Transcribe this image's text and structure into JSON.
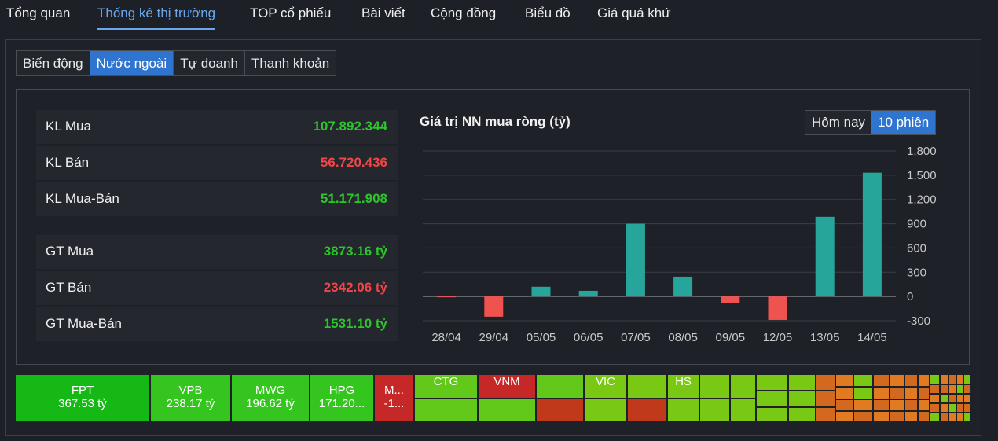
{
  "nav": {
    "items": [
      "Tổng quan",
      "Thống kê thị trường",
      "TOP cổ phiếu",
      "Bài viết",
      "Cộng đồng",
      "Biểu đồ",
      "Giá quá khứ"
    ],
    "active": "Thống kê thị trường"
  },
  "sub_tabs": {
    "items": [
      "Biến động",
      "Nước ngoài",
      "Tự doanh",
      "Thanh khoản"
    ],
    "active": "Nước ngoài"
  },
  "stats": [
    {
      "label": "KL Mua",
      "value": "107.892.344",
      "tone": "green"
    },
    {
      "label": "KL Bán",
      "value": "56.720.436",
      "tone": "red"
    },
    {
      "label": "KL Mua-Bán",
      "value": "51.171.908",
      "tone": "green"
    },
    {
      "label": "GT Mua",
      "value": "3873.16 tỷ",
      "tone": "green"
    },
    {
      "label": "GT Bán",
      "value": "2342.06 tỷ",
      "tone": "red"
    },
    {
      "label": "GT Mua-Bán",
      "value": "1531.10 tỷ",
      "tone": "green"
    }
  ],
  "chart": {
    "title": "Giá trị NN mua ròng (tỷ)",
    "range_options": [
      "Hôm nay",
      "10 phiên"
    ],
    "range_active": "10 phiên"
  },
  "chart_data": {
    "type": "bar",
    "title": "Giá trị NN mua ròng (tỷ)",
    "categories": [
      "28/04",
      "29/04",
      "05/05",
      "06/05",
      "07/05",
      "08/05",
      "09/05",
      "12/05",
      "13/05",
      "14/05"
    ],
    "values": [
      -5,
      -250,
      120,
      70,
      900,
      245,
      -80,
      -290,
      985,
      1531
    ],
    "ylim": [
      -300,
      1800
    ],
    "yticks": [
      "1,800",
      "1,500",
      "1,200",
      "900",
      "600",
      "300",
      "0",
      "-300"
    ],
    "ytick_values": [
      1800,
      1500,
      1200,
      900,
      600,
      300,
      0,
      -300
    ],
    "positive_color": "#26a69a",
    "negative_color": "#ef5350",
    "grid": true
  },
  "treemap": {
    "items": [
      {
        "code": "FPT",
        "value": "367.53 tỷ"
      },
      {
        "code": "VPB",
        "value": "238.17 tỷ"
      },
      {
        "code": "MWG",
        "value": "196.62 tỷ"
      },
      {
        "code": "HPG",
        "value": "171.20..."
      },
      {
        "code": "M...",
        "value": "-1..."
      },
      {
        "code": "CTG",
        "value": ""
      },
      {
        "code": "VNM",
        "value": ""
      },
      {
        "code": "VIC",
        "value": ""
      },
      {
        "code": "HS",
        "value": ""
      }
    ]
  }
}
